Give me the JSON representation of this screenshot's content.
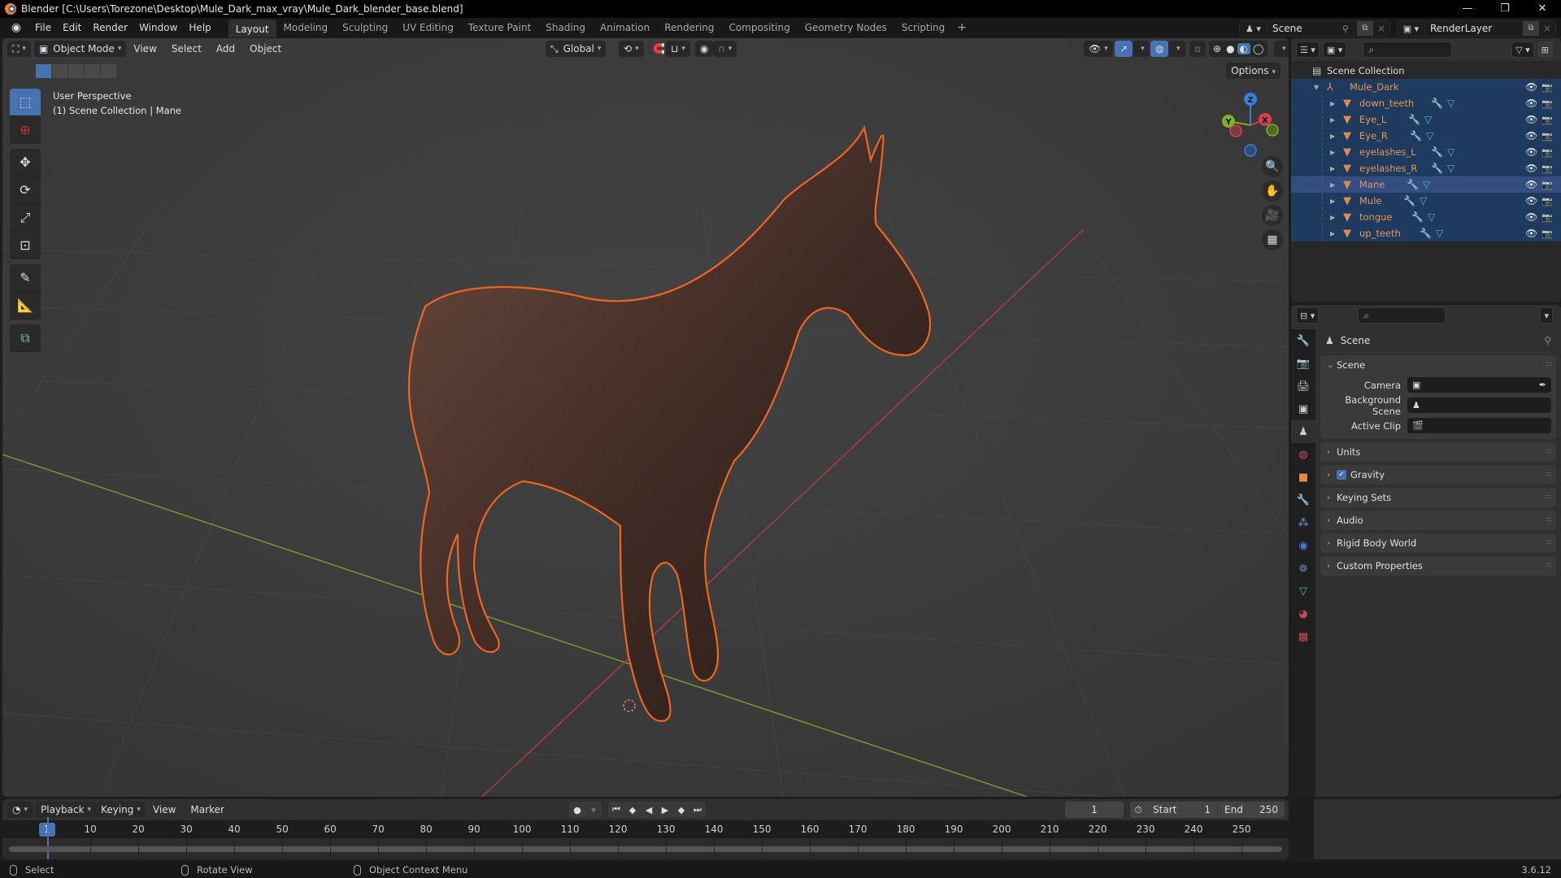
{
  "window": {
    "title": "Blender [C:\\Users\\Torezone\\Desktop\\Mule_Dark_max_vray\\Mule_Dark_blender_base.blend]",
    "controls": [
      "—",
      "❐",
      "✕"
    ]
  },
  "menubar": {
    "items": [
      "File",
      "Edit",
      "Render",
      "Window",
      "Help"
    ],
    "workspaces": [
      "Layout",
      "Modeling",
      "Sculpting",
      "UV Editing",
      "Texture Paint",
      "Shading",
      "Animation",
      "Rendering",
      "Compositing",
      "Geometry Nodes",
      "Scripting"
    ],
    "active_workspace": "Layout",
    "add_workspace": "+",
    "scene": "Scene",
    "view_layer": "RenderLayer"
  },
  "viewport": {
    "mode": "Object Mode",
    "menus": [
      "View",
      "Select",
      "Add",
      "Object"
    ],
    "transform_orientation": "Global",
    "options_label": "Options",
    "info_line1": "User Perspective",
    "info_line2": "(1) Scene Collection | Mane",
    "axes": {
      "x": "X",
      "y": "Y",
      "z": "Z"
    },
    "colors": {
      "x": "#d2404f",
      "y": "#7bb324",
      "z": "#2f83e3",
      "selection": "#f0641e"
    }
  },
  "outliner": {
    "root": "Scene Collection",
    "collection": "Mule_Dark",
    "objects": [
      {
        "name": "down_teeth",
        "active": false
      },
      {
        "name": "Eye_L",
        "active": false
      },
      {
        "name": "Eye_R",
        "active": false
      },
      {
        "name": "eyelashes_L",
        "active": false
      },
      {
        "name": "eyelashes_R",
        "active": false
      },
      {
        "name": "Mane",
        "active": true
      },
      {
        "name": "Mule",
        "active": false
      },
      {
        "name": "tongue",
        "active": false
      },
      {
        "name": "up_teeth",
        "active": false
      }
    ]
  },
  "properties": {
    "context_title": "Scene",
    "scene_panel": {
      "title": "Scene",
      "fields": [
        {
          "label": "Camera",
          "value": ""
        },
        {
          "label": "Background Scene",
          "value": ""
        },
        {
          "label": "Active Clip",
          "value": ""
        }
      ]
    },
    "panels": [
      {
        "title": "Units",
        "checkbox": null
      },
      {
        "title": "Gravity",
        "checkbox": true
      },
      {
        "title": "Keying Sets",
        "checkbox": null
      },
      {
        "title": "Audio",
        "checkbox": null
      },
      {
        "title": "Rigid Body World",
        "checkbox": null
      },
      {
        "title": "Custom Properties",
        "checkbox": null
      }
    ]
  },
  "timeline": {
    "menus": [
      "Playback",
      "Keying",
      "View",
      "Marker"
    ],
    "current_frame": "1",
    "start_label": "Start",
    "start": "1",
    "end_label": "End",
    "end": "250",
    "ruler": [
      "10",
      "20",
      "30",
      "40",
      "50",
      "60",
      "70",
      "80",
      "90",
      "100",
      "110",
      "120",
      "130",
      "140",
      "150",
      "160",
      "170",
      "180",
      "190",
      "200",
      "210",
      "220",
      "230",
      "240",
      "250"
    ],
    "cursor_label": "1"
  },
  "statusbar": {
    "select": "Select",
    "rotate": "Rotate View",
    "context": "Object Context Menu",
    "version": "3.6.12"
  }
}
